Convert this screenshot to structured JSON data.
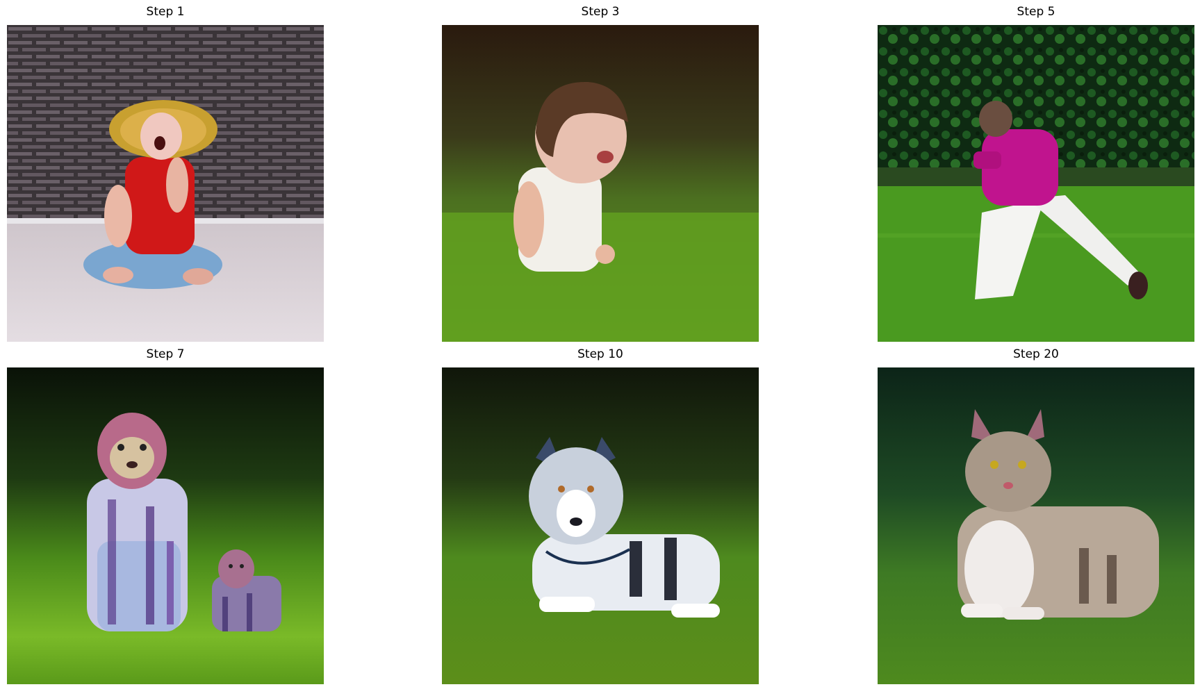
{
  "panels": [
    {
      "title": "Step 1",
      "subject": "toddler in straw hat and red top sitting on floor"
    },
    {
      "title": "Step 3",
      "subject": "toddler in white top on grass"
    },
    {
      "title": "Step 5",
      "subject": "person in magenta hoodie and white pants on lawn"
    },
    {
      "title": "Step 7",
      "subject": "two tigers sitting on grass"
    },
    {
      "title": "Step 10",
      "subject": "husky dog lying on grass"
    },
    {
      "title": "Step 20",
      "subject": "tabby cat lying on grass"
    }
  ],
  "colors": {
    "background": "#ffffff",
    "title_text": "#000000",
    "grass": "#5a9a1e",
    "dark_bg": "#1a2410"
  }
}
